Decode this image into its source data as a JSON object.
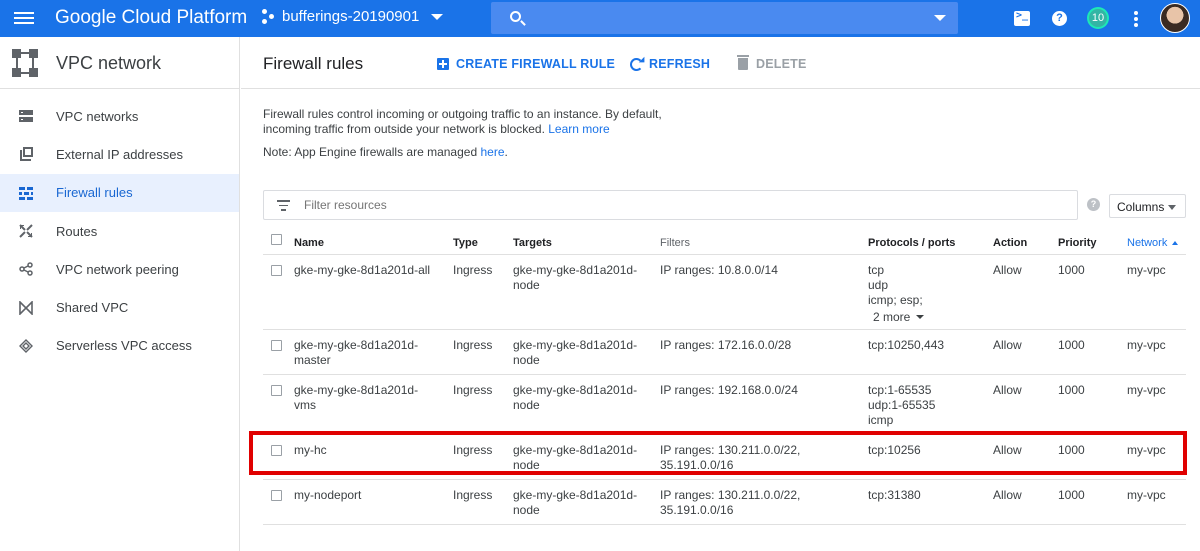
{
  "header": {
    "product_title": "Google Cloud Platform",
    "project_name": "bufferings-20190901",
    "notification_count": "10",
    "help_symbol": "?",
    "colors": {
      "bar": "#1a73e8",
      "highlight": "#e00000"
    }
  },
  "sidebar": {
    "title": "VPC network",
    "items": [
      {
        "label": "VPC networks",
        "icon": "servers-icon",
        "active": false
      },
      {
        "label": "External IP addresses",
        "icon": "external-ip-icon",
        "active": false
      },
      {
        "label": "Firewall rules",
        "icon": "firewall-icon",
        "active": true
      },
      {
        "label": "Routes",
        "icon": "routes-icon",
        "active": false
      },
      {
        "label": "VPC network peering",
        "icon": "peering-icon",
        "active": false
      },
      {
        "label": "Shared VPC",
        "icon": "shared-vpc-icon",
        "active": false
      },
      {
        "label": "Serverless VPC access",
        "icon": "serverless-icon",
        "active": false
      }
    ]
  },
  "toolbar": {
    "page_title": "Firewall rules",
    "create_label": "CREATE FIREWALL RULE",
    "refresh_label": "REFRESH",
    "delete_label": "DELETE"
  },
  "intro": {
    "line1": "Firewall rules control incoming or outgoing traffic to an instance. By default,",
    "line2": "incoming traffic from outside your network is blocked.",
    "learn_more": "Learn more",
    "note_prefix": "Note: App Engine firewalls are managed",
    "note_link": "here",
    "note_suffix": "."
  },
  "filter": {
    "placeholder": "Filter resources",
    "help_symbol": "?",
    "columns_label": "Columns"
  },
  "table": {
    "headers": {
      "name": "Name",
      "type": "Type",
      "targets": "Targets",
      "filters": "Filters",
      "protocols": "Protocols / ports",
      "action": "Action",
      "priority": "Priority",
      "network": "Network"
    },
    "rows": [
      {
        "name": [
          "gke-my-gke-8d1a201d-all"
        ],
        "type": "Ingress",
        "targets": [
          "gke-my-gke-8d1a201d-",
          "node"
        ],
        "filters": [
          "IP ranges: 10.8.0.0/14"
        ],
        "protocols": [
          "tcp",
          "udp",
          "icmp; esp;"
        ],
        "more": "2 more",
        "action": "Allow",
        "priority": "1000",
        "network": "my-vpc"
      },
      {
        "name": [
          "gke-my-gke-8d1a201d-",
          "master"
        ],
        "type": "Ingress",
        "targets": [
          "gke-my-gke-8d1a201d-",
          "node"
        ],
        "filters": [
          "IP ranges: 172.16.0.0/28"
        ],
        "protocols": [
          "tcp:10250,443"
        ],
        "action": "Allow",
        "priority": "1000",
        "network": "my-vpc"
      },
      {
        "name": [
          "gke-my-gke-8d1a201d-",
          "vms"
        ],
        "type": "Ingress",
        "targets": [
          "gke-my-gke-8d1a201d-",
          "node"
        ],
        "filters": [
          "IP ranges: 192.168.0.0/24"
        ],
        "protocols": [
          "tcp:1-65535",
          "udp:1-65535",
          "icmp"
        ],
        "action": "Allow",
        "priority": "1000",
        "network": "my-vpc"
      },
      {
        "name": [
          "my-hc"
        ],
        "type": "Ingress",
        "targets": [
          "gke-my-gke-8d1a201d-",
          "node"
        ],
        "filters": [
          "IP ranges: 130.211.0.0/22,",
          "35.191.0.0/16"
        ],
        "protocols": [
          "tcp:10256"
        ],
        "action": "Allow",
        "priority": "1000",
        "network": "my-vpc"
      },
      {
        "name": [
          "my-nodeport"
        ],
        "type": "Ingress",
        "targets": [
          "gke-my-gke-8d1a201d-",
          "node"
        ],
        "filters": [
          "IP ranges: 130.211.0.0/22,",
          "35.191.0.0/16"
        ],
        "protocols": [
          "tcp:31380"
        ],
        "action": "Allow",
        "priority": "1000",
        "network": "my-vpc"
      }
    ]
  }
}
